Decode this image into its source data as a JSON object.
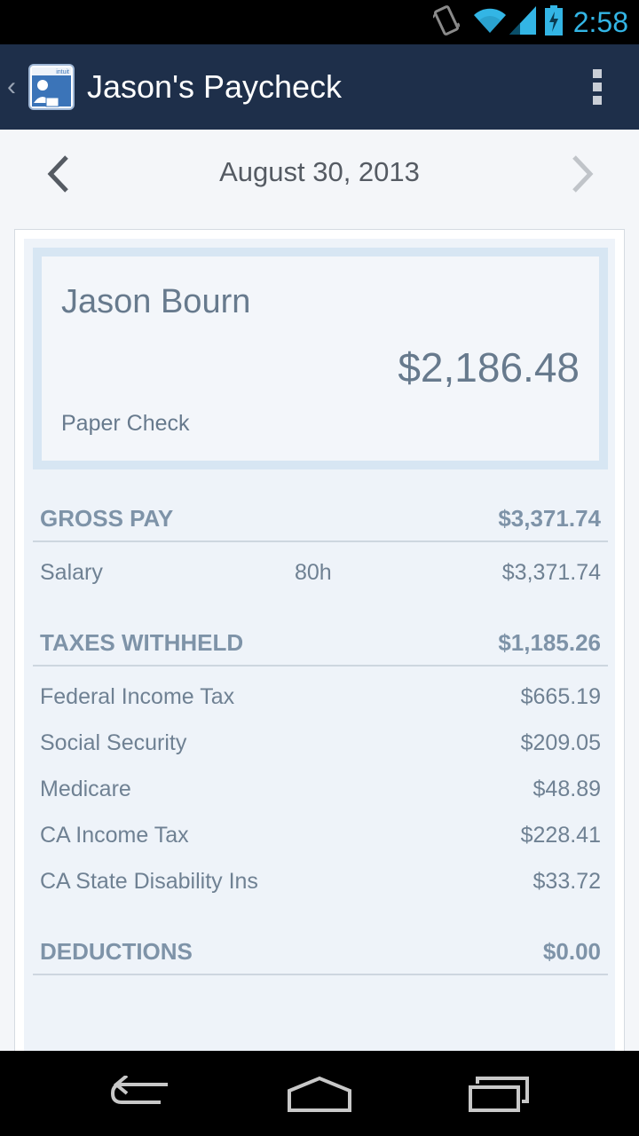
{
  "status_bar": {
    "time": "2:58",
    "icons": [
      "vibrate-icon",
      "wifi-icon",
      "signal-icon",
      "battery-charging-icon"
    ]
  },
  "action_bar": {
    "title": "Jason's Paycheck",
    "app_icon": "intuit-payroll-icon",
    "overflow_icon": "overflow-menu-icon"
  },
  "date_nav": {
    "date": "August 30, 2013",
    "prev_icon": "chevron-left-icon",
    "next_icon": "chevron-right-icon"
  },
  "summary": {
    "employee_name": "Jason Bourn",
    "net_pay": "$2,186.48",
    "payment_method": "Paper Check"
  },
  "gross_pay": {
    "label": "GROSS PAY",
    "total": "$3,371.74",
    "items": [
      {
        "label": "Salary",
        "hours": "80h",
        "amount": "$3,371.74"
      }
    ]
  },
  "taxes_withheld": {
    "label": "TAXES WITHHELD",
    "total": "$1,185.26",
    "items": [
      {
        "label": "Federal Income Tax",
        "amount": "$665.19"
      },
      {
        "label": "Social Security",
        "amount": "$209.05"
      },
      {
        "label": "Medicare",
        "amount": "$48.89"
      },
      {
        "label": "CA Income Tax",
        "amount": "$228.41"
      },
      {
        "label": "CA State Disability Ins",
        "amount": "$33.72"
      }
    ]
  },
  "deductions": {
    "label": "DEDUCTIONS",
    "total": "$0.00"
  },
  "nav_bar": {
    "icons": [
      "back-icon",
      "home-icon",
      "recents-icon"
    ]
  },
  "colors": {
    "action_bar": "#1e2f4a",
    "status_time": "#33b5e5",
    "section_text": "#7e93a8",
    "card_tint": "#eef3f9"
  }
}
